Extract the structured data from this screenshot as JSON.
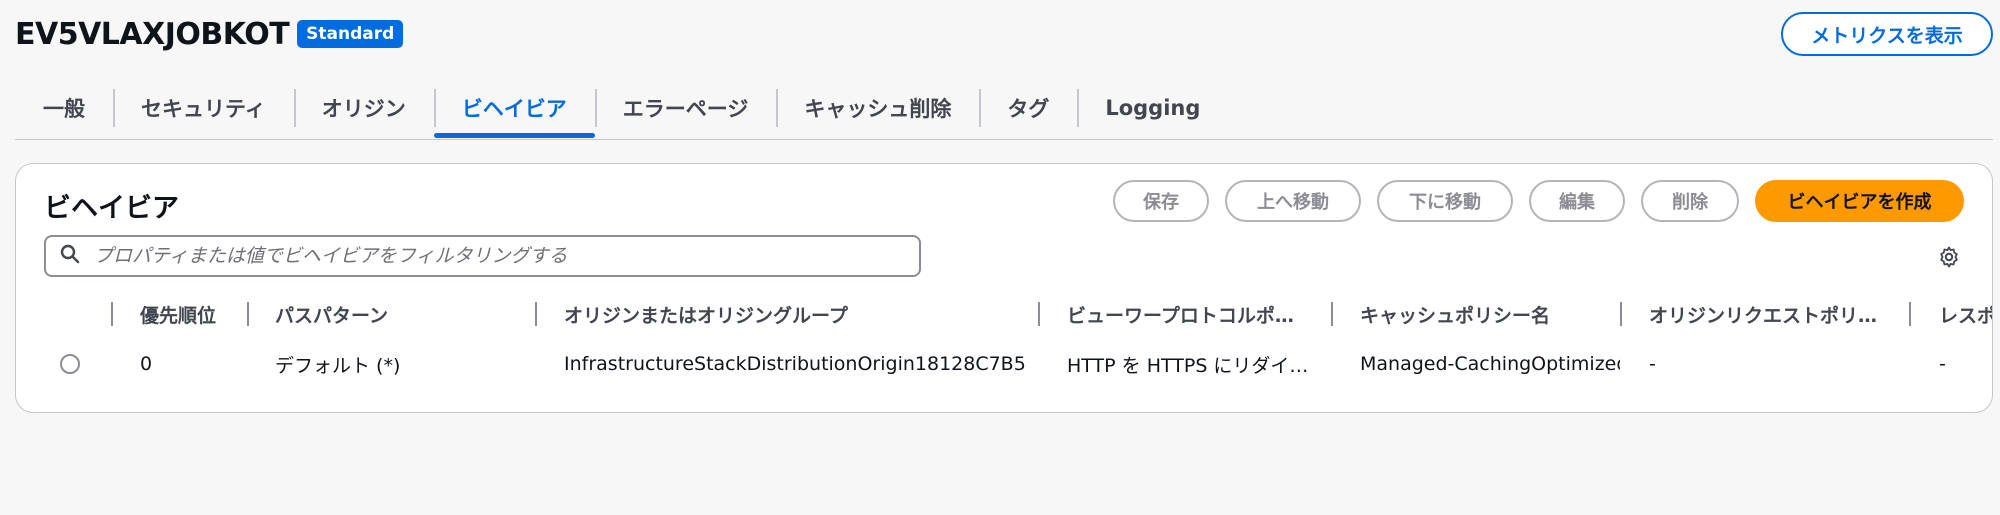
{
  "header": {
    "distribution_id": "EV5VLAXJOBKOT",
    "badge": "Standard",
    "metrics_button": "メトリクスを表示"
  },
  "tabs": [
    {
      "label": "一般"
    },
    {
      "label": "セキュリティ"
    },
    {
      "label": "オリジン"
    },
    {
      "label": "ビヘイビア",
      "active": true
    },
    {
      "label": "エラーページ"
    },
    {
      "label": "キャッシュ削除"
    },
    {
      "label": "タグ"
    },
    {
      "label": "Logging"
    }
  ],
  "panel": {
    "title": "ビヘイビア",
    "actions": {
      "save": "保存",
      "move_up": "上へ移動",
      "move_down": "下に移動",
      "edit": "編集",
      "delete": "削除",
      "create": "ビヘイビアを作成"
    },
    "search_placeholder": "プロパティまたは値でビヘイビアをフィルタリングする",
    "columns": {
      "priority": "優先順位",
      "path_pattern": "パスパターン",
      "origin": "オリジンまたはオリジングループ",
      "viewer_protocol": "ビューワープロトコルポ…",
      "cache_policy": "キャッシュポリシー名",
      "origin_request_policy": "オリジンリクエストポリ…",
      "response": "レスポンス"
    },
    "rows": [
      {
        "priority": "0",
        "path_pattern": "デフォルト (*)",
        "origin": "InfrastructureStackDistributionOrigin18128C7B5",
        "viewer_protocol": "HTTP を HTTPS にリダイ…",
        "cache_policy": "Managed-CachingOptimized",
        "origin_request_policy": "-",
        "response": "-"
      }
    ]
  },
  "colors": {
    "accent": "#006ce0",
    "primary_button": "#ff9900",
    "background": "#f8f7f7"
  }
}
